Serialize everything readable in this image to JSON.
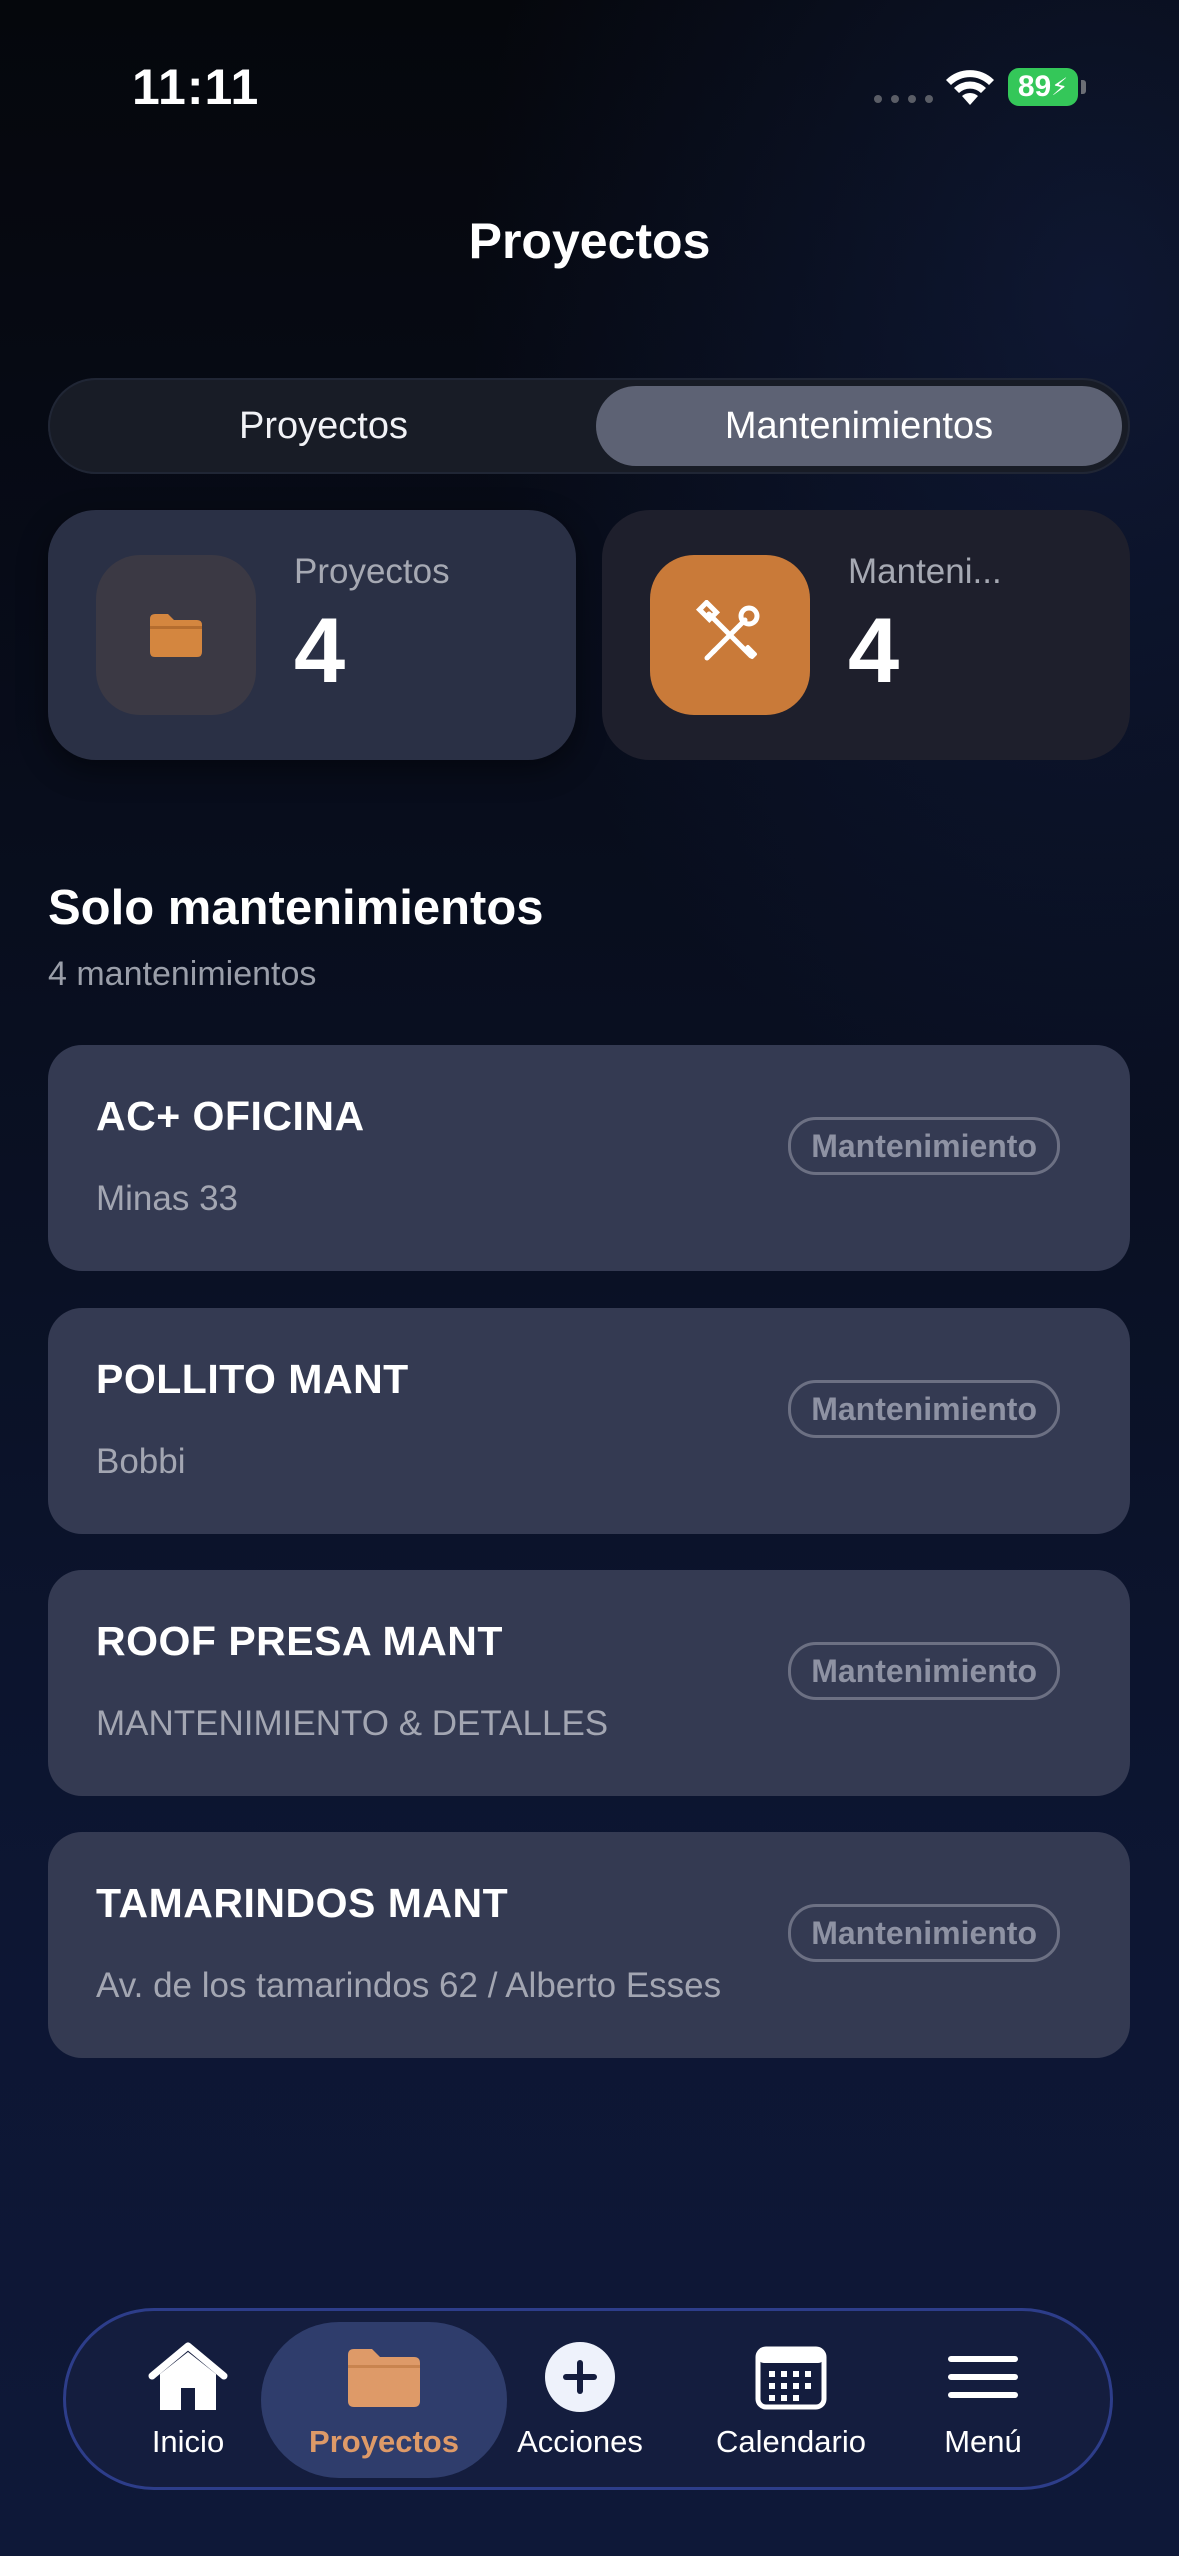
{
  "status_bar": {
    "time": "11:11",
    "battery": "89"
  },
  "header": {
    "title": "Proyectos"
  },
  "segmented": {
    "items": [
      {
        "label": "Proyectos",
        "selected": false
      },
      {
        "label": "Mantenimientos",
        "selected": true
      }
    ]
  },
  "stats": [
    {
      "label": "Proyectos",
      "value": "4",
      "icon": "folder-icon",
      "accent": "#c97a39"
    },
    {
      "label": "Manteni...",
      "value": "4",
      "icon": "wrench-screwdriver-icon",
      "accent": "#c97a39"
    }
  ],
  "section": {
    "title": "Solo mantenimientos",
    "subtitle": "4 mantenimientos"
  },
  "items": [
    {
      "title": "AC+ OFICINA",
      "subtitle": "Minas 33",
      "badge": "Mantenimiento"
    },
    {
      "title": "POLLITO MANT",
      "subtitle": "Bobbi",
      "badge": "Mantenimiento"
    },
    {
      "title": "ROOF PRESA MANT",
      "subtitle": "MANTENIMIENTO & DETALLES",
      "badge": "Mantenimiento"
    },
    {
      "title": "TAMARINDOS MANT",
      "subtitle": "Av. de los tamarindos 62 / Alberto Esses",
      "badge": "Mantenimiento"
    }
  ],
  "nav": {
    "items": [
      {
        "label": "Inicio",
        "icon": "home-icon",
        "active": false
      },
      {
        "label": "Proyectos",
        "icon": "folder-icon",
        "active": true
      },
      {
        "label": "Acciones",
        "icon": "plus-circle-icon",
        "active": false
      },
      {
        "label": "Calendario",
        "icon": "calendar-icon",
        "active": false
      },
      {
        "label": "Menú",
        "icon": "menu-icon",
        "active": false
      }
    ]
  }
}
